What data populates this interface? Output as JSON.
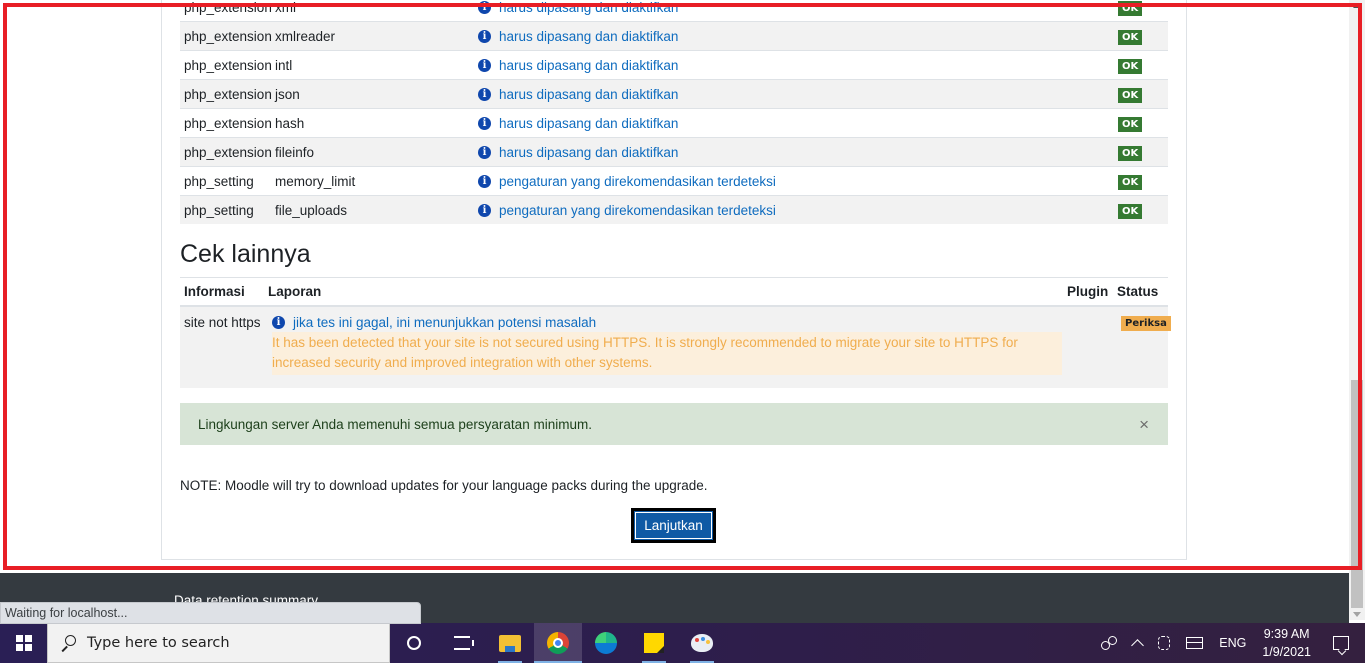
{
  "env_checks": {
    "rows": [
      {
        "type": "php_extension",
        "name": "xml",
        "report": "harus dipasang dan diaktifkan",
        "status": "OK"
      },
      {
        "type": "php_extension",
        "name": "xmlreader",
        "report": "harus dipasang dan diaktifkan",
        "status": "OK"
      },
      {
        "type": "php_extension",
        "name": "intl",
        "report": "harus dipasang dan diaktifkan",
        "status": "OK"
      },
      {
        "type": "php_extension",
        "name": "json",
        "report": "harus dipasang dan diaktifkan",
        "status": "OK"
      },
      {
        "type": "php_extension",
        "name": "hash",
        "report": "harus dipasang dan diaktifkan",
        "status": "OK"
      },
      {
        "type": "php_extension",
        "name": "fileinfo",
        "report": "harus dipasang dan diaktifkan",
        "status": "OK"
      },
      {
        "type": "php_setting",
        "name": "memory_limit",
        "report": "pengaturan yang direkomendasikan terdeteksi",
        "status": "OK"
      },
      {
        "type": "php_setting",
        "name": "file_uploads",
        "report": "pengaturan yang direkomendasikan terdeteksi",
        "status": "OK"
      }
    ]
  },
  "other_checks": {
    "title": "Cek lainnya",
    "headers": {
      "info": "Informasi",
      "report": "Laporan",
      "plugin": "Plugin",
      "status": "Status"
    },
    "rows": [
      {
        "info": "site not https",
        "report": "jika tes ini gagal, ini menunjukkan potensi masalah",
        "warning": "It has been detected that your site is not secured using HTTPS. It is strongly recommended to migrate your site to HTTPS for increased security and improved integration with other systems.",
        "plugin": "",
        "status": "Periksa"
      }
    ]
  },
  "alert": {
    "message": "Lingkungan server Anda memenuhi semua persyaratan minimum.",
    "close_label": "×"
  },
  "note": "NOTE: Moodle will try to download updates for your language packs during the upgrade.",
  "continue_button": "Lanjutkan",
  "footer": {
    "link": "Data retention summary"
  },
  "browser_status": "Waiting for localhost...",
  "taskbar": {
    "search_placeholder": "Type here to search",
    "apps": [
      "cortana",
      "task-view",
      "file-explorer",
      "chrome",
      "edge",
      "sticky-notes",
      "paint"
    ],
    "language": "ENG",
    "time": "9:39 AM",
    "date": "1/9/2021"
  },
  "colors": {
    "ok_badge": "#357a32",
    "warn_badge": "#f0ad4e",
    "link": "#0f6cbf",
    "primary_button": "#0f5aa5",
    "alert_success_bg": "#d7e4d6",
    "highlight_frame": "#e81e25"
  }
}
